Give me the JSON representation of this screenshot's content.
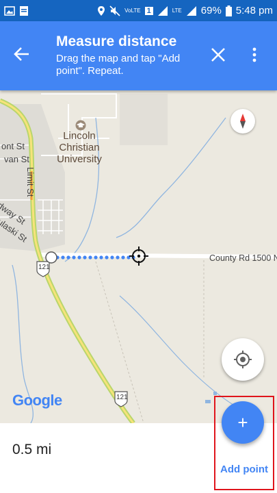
{
  "status_bar": {
    "volte_label": "VoLTE",
    "lte_label": "LTE",
    "sim_label": "1",
    "battery": "69%",
    "time": "5:48 pm"
  },
  "header": {
    "title": "Measure distance",
    "subtitle": "Drag the map and tap \"Add point\". Repeat."
  },
  "map": {
    "poi_label": "Lincoln Christian University",
    "streets": [
      "ont St",
      "van St",
      "Limit St",
      "dway St",
      "ulaski St",
      "County Rd 1500 N"
    ],
    "route_shields": [
      "121",
      "121"
    ],
    "attribution": "Google"
  },
  "measurement": {
    "distance": "0.5 mi"
  },
  "actions": {
    "add_point_icon": "+",
    "add_point_label": "Add point"
  },
  "colors": {
    "accent": "#4285f4",
    "status_bar": "#1565c0",
    "highlight": "#e0141b"
  }
}
